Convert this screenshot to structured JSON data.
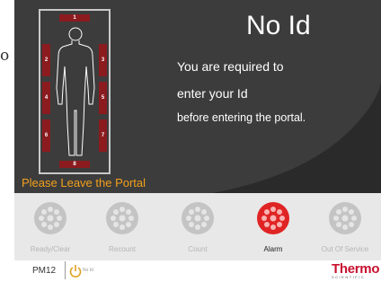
{
  "edge_char": "o",
  "status": {
    "title": "No Id",
    "line1": "You are required to",
    "line2": "enter your Id",
    "line3": "before entering the portal.",
    "warning": "Please Leave the Portal"
  },
  "zones": [
    "1",
    "2",
    "3",
    "4",
    "5",
    "6",
    "7",
    "8"
  ],
  "buttons": [
    {
      "label": "Ready/Clear",
      "active": false
    },
    {
      "label": "Recount",
      "active": false
    },
    {
      "label": "Count",
      "active": false
    },
    {
      "label": "Alarm",
      "active": true
    },
    {
      "label": "Out Of Service",
      "active": false
    }
  ],
  "footer": {
    "portal_id": "PM12",
    "small_status": "No Id",
    "logo_main": "Thermo",
    "logo_sub": "SCIENTIFIC"
  },
  "colors": {
    "panel": "#3c3c3c",
    "zone": "#8b1b1f",
    "alarm_active": "#e02424",
    "inactive_button": "#c4c4c4",
    "warning_text": "#f2a01b",
    "brand": "#c8102e"
  }
}
